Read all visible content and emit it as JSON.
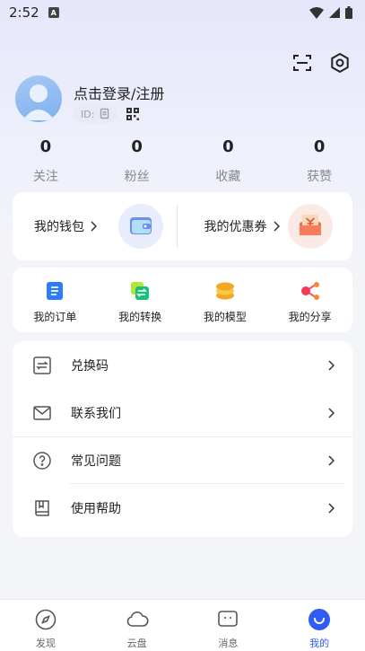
{
  "status_bar": {
    "time": "2:52",
    "notification_letter": "A"
  },
  "profile": {
    "login_prompt": "点击登录/注册",
    "id_label": "ID:"
  },
  "stats": [
    {
      "value": "0",
      "label": "关注"
    },
    {
      "value": "0",
      "label": "粉丝"
    },
    {
      "value": "0",
      "label": "收藏"
    },
    {
      "value": "0",
      "label": "获赞"
    }
  ],
  "wallet": {
    "wallet_label": "我的钱包",
    "coupon_label": "我的优惠券"
  },
  "orders": [
    {
      "label": "我的订单",
      "icon": "order-icon"
    },
    {
      "label": "我的转换",
      "icon": "convert-icon"
    },
    {
      "label": "我的模型",
      "icon": "model-icon"
    },
    {
      "label": "我的分享",
      "icon": "share-icon"
    }
  ],
  "menu": [
    {
      "label": "兑换码",
      "icon": "redeem-icon"
    },
    {
      "label": "联系我们",
      "icon": "mail-icon"
    },
    {
      "label": "常见问题",
      "icon": "question-icon"
    },
    {
      "label": "使用帮助",
      "icon": "book-icon"
    }
  ],
  "tabs": [
    {
      "label": "发现",
      "icon": "compass-icon",
      "active": false
    },
    {
      "label": "云盘",
      "icon": "cloud-icon",
      "active": false
    },
    {
      "label": "消息",
      "icon": "message-icon",
      "active": false
    },
    {
      "label": "我的",
      "icon": "profile-icon",
      "active": true
    }
  ],
  "colors": {
    "accent": "#2f5cf5",
    "text": "#222222",
    "muted": "#888888"
  }
}
